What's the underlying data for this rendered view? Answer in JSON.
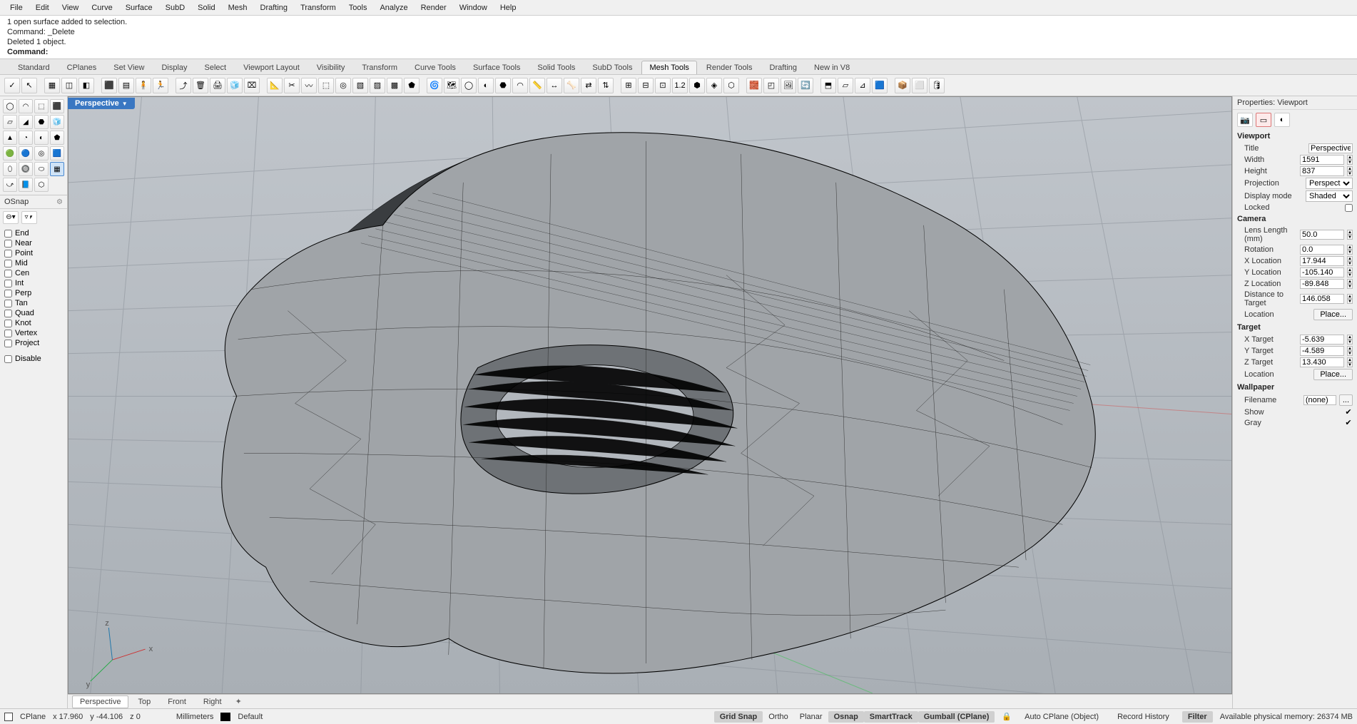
{
  "menu": [
    "File",
    "Edit",
    "View",
    "Curve",
    "Surface",
    "SubD",
    "Solid",
    "Mesh",
    "Drafting",
    "Transform",
    "Tools",
    "Analyze",
    "Render",
    "Window",
    "Help"
  ],
  "command_history": {
    "l1": "1 open surface added to selection.",
    "l2": "Command: _Delete",
    "l3": "Deleted 1 object.",
    "prompt": "Command:"
  },
  "tool_tabs": [
    "Standard",
    "CPlanes",
    "Set View",
    "Display",
    "Select",
    "Viewport Layout",
    "Visibility",
    "Transform",
    "Curve Tools",
    "Surface Tools",
    "Solid Tools",
    "SubD Tools",
    "Mesh Tools",
    "Render Tools",
    "Drafting",
    "New in V8"
  ],
  "tool_tabs_active": "Mesh Tools",
  "viewport": {
    "name": "Perspective"
  },
  "bottom_tabs": [
    "Perspective",
    "Top",
    "Front",
    "Right"
  ],
  "bottom_active": "Perspective",
  "osnap": {
    "title": "OSnap",
    "items": [
      "End",
      "Near",
      "Point",
      "Mid",
      "Cen",
      "Int",
      "Perp",
      "Tan",
      "Quad",
      "Knot",
      "Vertex",
      "Project"
    ],
    "disable": "Disable"
  },
  "properties": {
    "title": "Properties: Viewport",
    "viewport_h": "Viewport",
    "title_lbl": "Title",
    "title_val": "Perspective",
    "width_lbl": "Width",
    "width_val": "1591",
    "height_lbl": "Height",
    "height_val": "837",
    "proj_lbl": "Projection",
    "proj_val": "Perspective",
    "disp_lbl": "Display mode",
    "disp_val": "Shaded",
    "lock_lbl": "Locked",
    "camera_h": "Camera",
    "lens_lbl": "Lens Length (mm)",
    "lens_val": "50.0",
    "rot_lbl": "Rotation",
    "rot_val": "0.0",
    "xl_lbl": "X Location",
    "xl_val": "17.944",
    "yl_lbl": "Y Location",
    "yl_val": "-105.140",
    "zl_lbl": "Z Location",
    "zl_val": "-89.848",
    "dist_lbl": "Distance to Target",
    "dist_val": "146.058",
    "loc_lbl": "Location",
    "place": "Place...",
    "target_h": "Target",
    "xt_lbl": "X Target",
    "xt_val": "-5.639",
    "yt_lbl": "Y Target",
    "yt_val": "-4.589",
    "zt_lbl": "Z Target",
    "zt_val": "13.430",
    "wall_h": "Wallpaper",
    "file_lbl": "Filename",
    "file_val": "(none)",
    "file_btn": "...",
    "show_lbl": "Show",
    "gray_lbl": "Gray"
  },
  "status": {
    "cplane": "CPlane",
    "x": "x 17.960",
    "y": "y -44.106",
    "z": "z 0",
    "units": "Millimeters",
    "layer": "Default",
    "buttons": [
      "Grid Snap",
      "Ortho",
      "Planar",
      "Osnap",
      "SmartTrack",
      "Gumball (CPlane)"
    ],
    "autocp": "Auto CPlane (Object)",
    "rec": "Record History",
    "filter": "Filter",
    "mem": "Available physical memory: 26374 MB"
  }
}
